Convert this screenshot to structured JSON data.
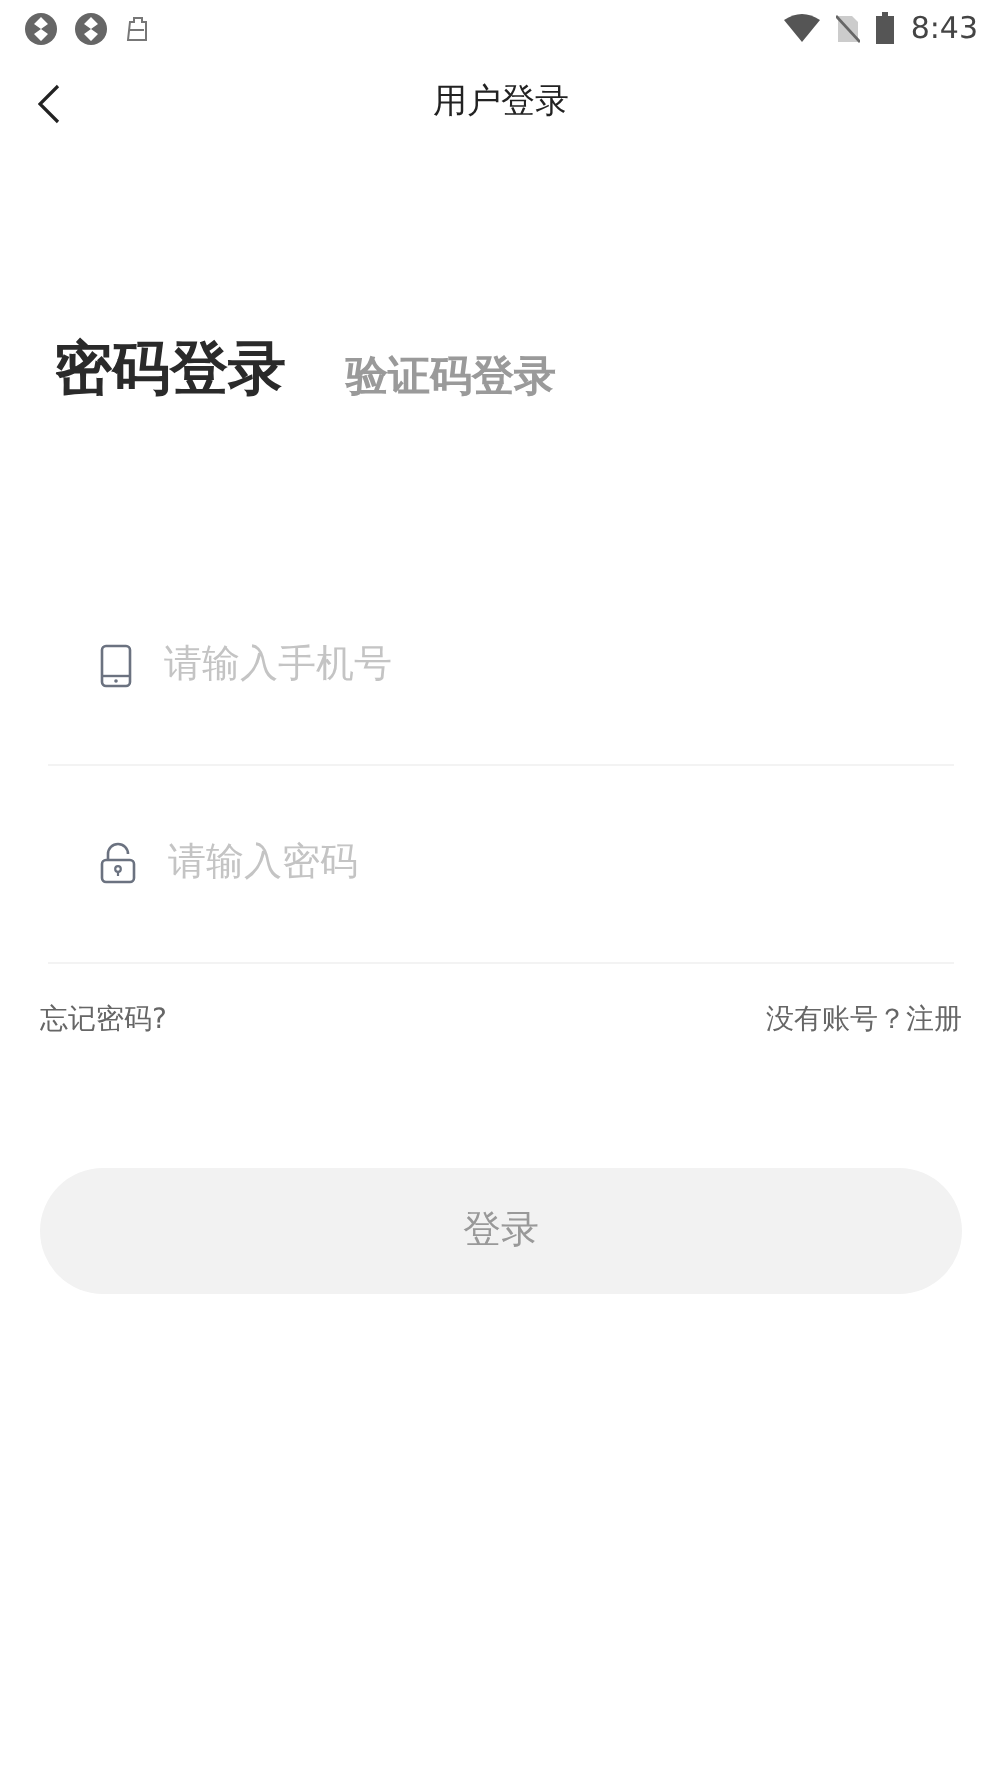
{
  "status_bar": {
    "time": "8:43"
  },
  "header": {
    "title": "用户登录"
  },
  "tabs": [
    {
      "label": "密码登录",
      "selected": true
    },
    {
      "label": "验证码登录",
      "selected": false
    }
  ],
  "fields": [
    {
      "kind": "phone",
      "placeholder": "请输入手机号"
    },
    {
      "kind": "password",
      "placeholder": "请输入密码"
    }
  ],
  "links": {
    "forgot": "忘记密码?",
    "register": "没有账号？注册"
  },
  "login_button": {
    "label": "登录",
    "disabled": true
  }
}
